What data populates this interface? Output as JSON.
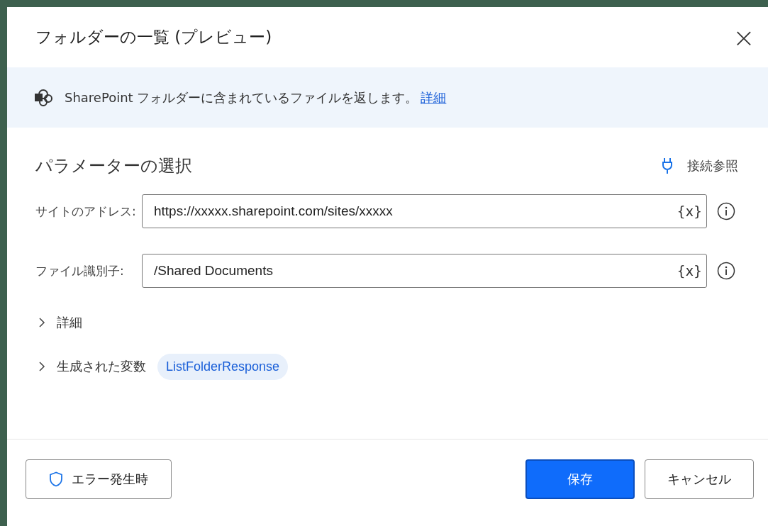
{
  "dialog": {
    "title": "フォルダーの一覧 (プレビュー)",
    "close": "×"
  },
  "banner": {
    "text": "SharePoint フォルダーに含まれているファイルを返します。",
    "link": "詳細"
  },
  "section": {
    "title": "パラメーターの選択",
    "connection": "接続参照"
  },
  "fields": [
    {
      "label": "サイトのアドレス:",
      "value": "https://xxxxx.sharepoint.com/sites/xxxxx",
      "variable_button": "{x}"
    },
    {
      "label": "ファイル識別子:",
      "value": "/Shared Documents",
      "variable_button": "{x}"
    }
  ],
  "expanders": [
    {
      "label": "詳細",
      "expanded": false
    },
    {
      "label": "生成された変数",
      "expanded": false,
      "chips": [
        "ListFolderResponse"
      ]
    }
  ],
  "footer": {
    "error_button": "エラー発生時",
    "buttons": [
      {
        "label": "保存",
        "kind": "primary"
      },
      {
        "label": "キャンセル",
        "kind": "secondary"
      }
    ]
  }
}
